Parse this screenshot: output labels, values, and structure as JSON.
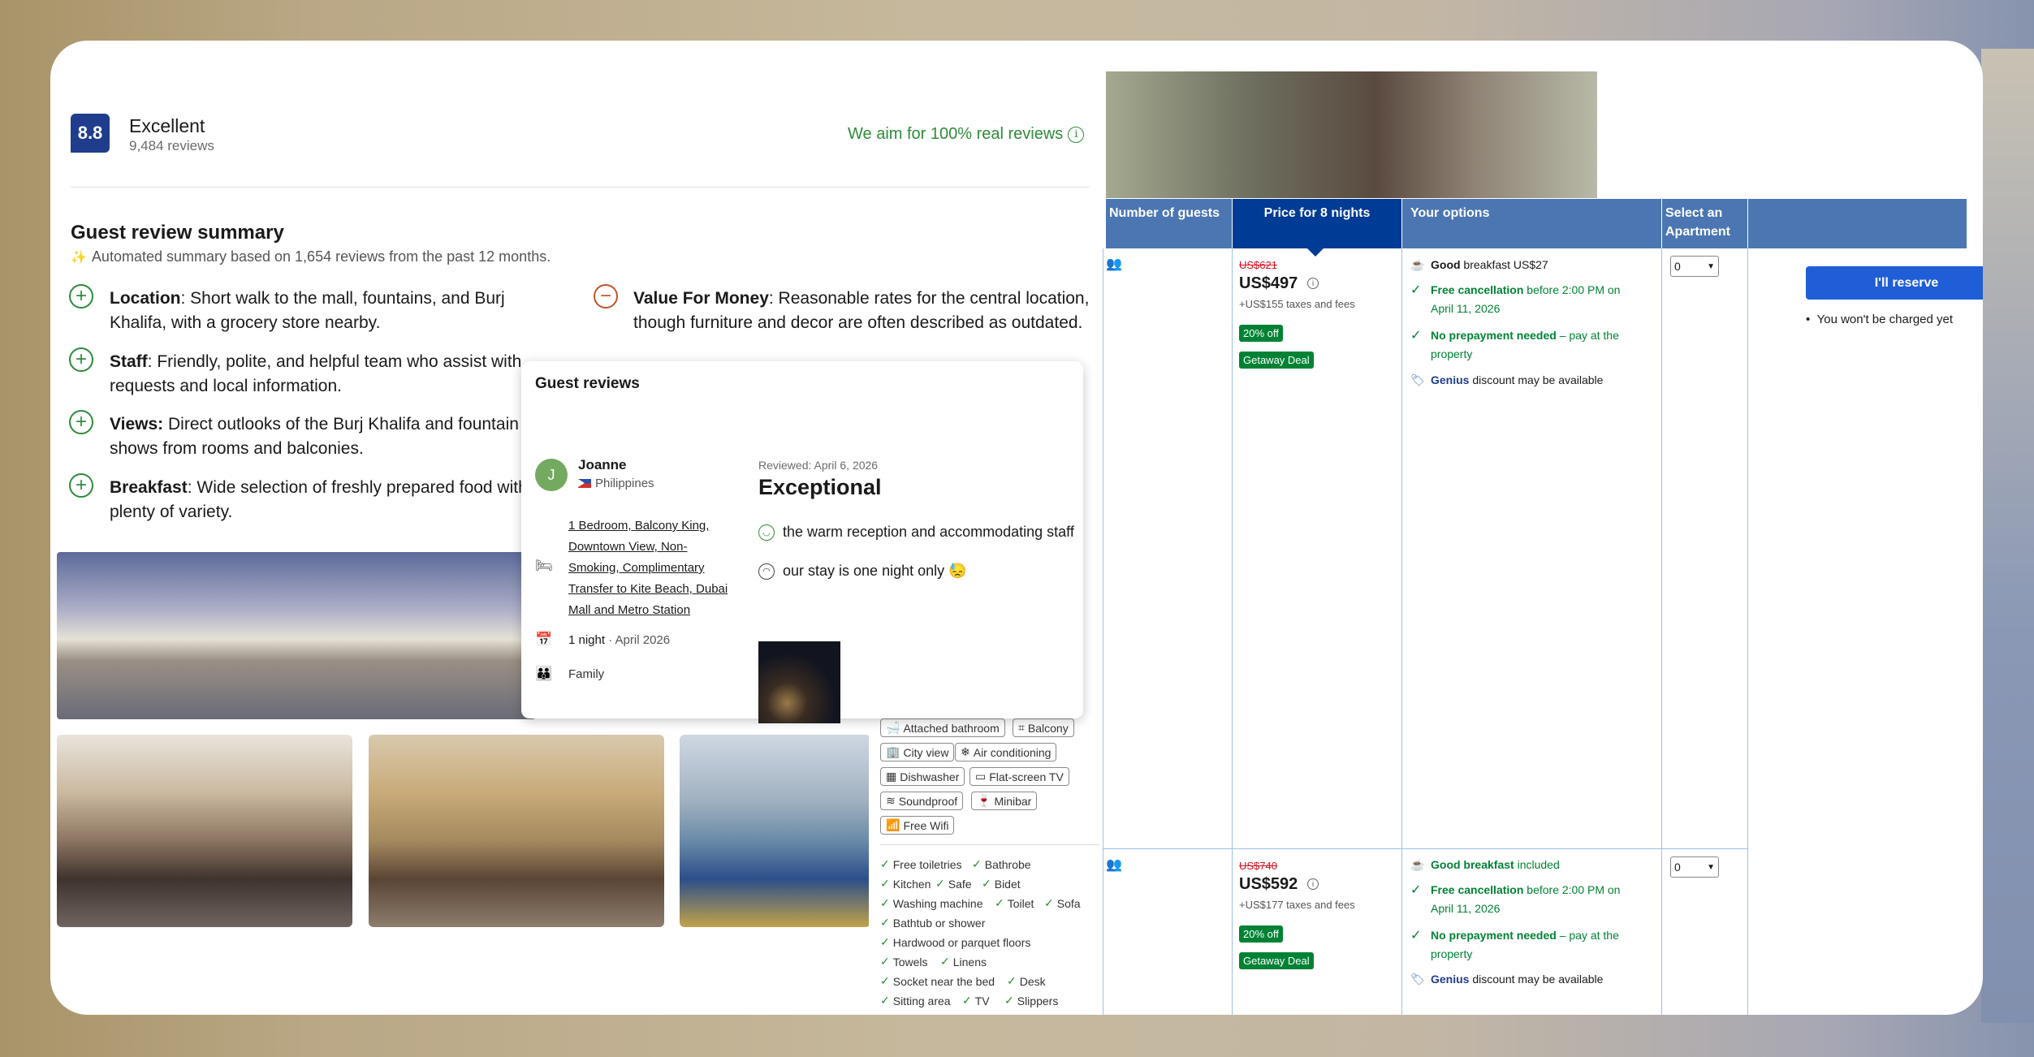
{
  "header": {
    "score": "8.8",
    "rating": "Excellent",
    "review_count": "9,484 reviews",
    "real_reviews": "We aim for 100% real reviews",
    "info_icon": "i"
  },
  "summary": {
    "title": "Guest review summary",
    "subtitle": "Automated summary based on 1,654 reviews from the past 12 months.",
    "points": [
      {
        "icon": "plus-icon",
        "label": "Location",
        "text": ": Short walk to the mall, fountains, and Burj Khalifa, with a grocery store nearby."
      },
      {
        "icon": "plus-icon",
        "label": "Staff",
        "text": ": Friendly, polite, and helpful team who assist with requests and local information."
      },
      {
        "icon": "plus-icon",
        "label": "Views:",
        "text": " Direct outlooks of the Burj Khalifa and fountain shows from rooms and balconies."
      },
      {
        "icon": "plus-icon",
        "label": "Breakfast",
        "text": ": Wide selection of freshly prepared food with plenty of variety."
      },
      {
        "icon": "minus-icon",
        "label": "Value For Money",
        "text": ": Reasonable rates for the central location, though furniture and decor are often described as outdated."
      }
    ]
  },
  "popup": {
    "title": "Guest reviews",
    "reviewer": {
      "initial": "J",
      "name": "Joanne",
      "country": "Philippines"
    },
    "room": "1 Bedroom, Balcony King, Downtown View, Non-Smoking, Complimentary Transfer to Kite Beach, Dubai Mall and Metro Station",
    "stay_nights": "1 night",
    "stay_date": "· April 2026",
    "traveler_type": "Family",
    "reviewed": "Reviewed: April 6, 2026",
    "review_title": "Exceptional",
    "positive": "the warm reception and accommodating staff",
    "negative": "our stay is one night only 😓"
  },
  "amenity_chips": [
    "Attached bathroom",
    "Balcony",
    "City view",
    "Air conditioning",
    "Dishwasher",
    "Flat-screen TV",
    "Soundproof",
    "Minibar",
    "Free Wifi"
  ],
  "amenity_checks": [
    "Free toiletries",
    "Bathrobe",
    "Kitchen",
    "Safe",
    "Bidet",
    "Washing machine",
    "Toilet",
    "Sofa",
    "Bathtub or shower",
    "Hardwood or parquet floors",
    "Towels",
    "Linens",
    "Socket near the bed",
    "Desk",
    "Sitting area",
    "TV",
    "Slippers"
  ],
  "table": {
    "headers": {
      "guests": "Number of guests",
      "price": "Price for 8 nights",
      "options": "Your options",
      "select": "Select an Apartment"
    },
    "reserve_label": "I'll reserve",
    "no_charge": "You won't be charged yet",
    "rows": [
      {
        "guests_icon": "👥",
        "old_price": "US$621",
        "price": "US$497",
        "taxes": "+US$155 taxes and fees",
        "discount": "20% off",
        "deal": "Getaway Deal",
        "breakfast_b": "Good",
        "breakfast": " breakfast US$27",
        "cancel_b": "Free cancellation",
        "cancel": " before 2:00 PM on April 11, 2026",
        "prepay_b": "No prepayment needed",
        "prepay": " – pay at the property",
        "genius_b": "Genius",
        "genius": " discount may be available",
        "select_value": "0"
      },
      {
        "guests_icon": "👥",
        "old_price": "US$740",
        "price": "US$592",
        "taxes": "+US$177 taxes and fees",
        "discount": "20% off",
        "deal": "Getaway Deal",
        "breakfast_b": "Good breakfast",
        "breakfast": " included",
        "cancel_b": "Free cancellation",
        "cancel": " before 2:00 PM on April 11, 2026",
        "prepay_b": "No prepayment needed",
        "prepay": " – pay at the property",
        "genius_b": "Genius",
        "genius": " discount may be available",
        "select_value": "0"
      }
    ]
  },
  "colors": {
    "brand": "#003b95",
    "header_blue": "#4c76b2",
    "green": "#008234",
    "score_bg": "#1f3d8c"
  }
}
